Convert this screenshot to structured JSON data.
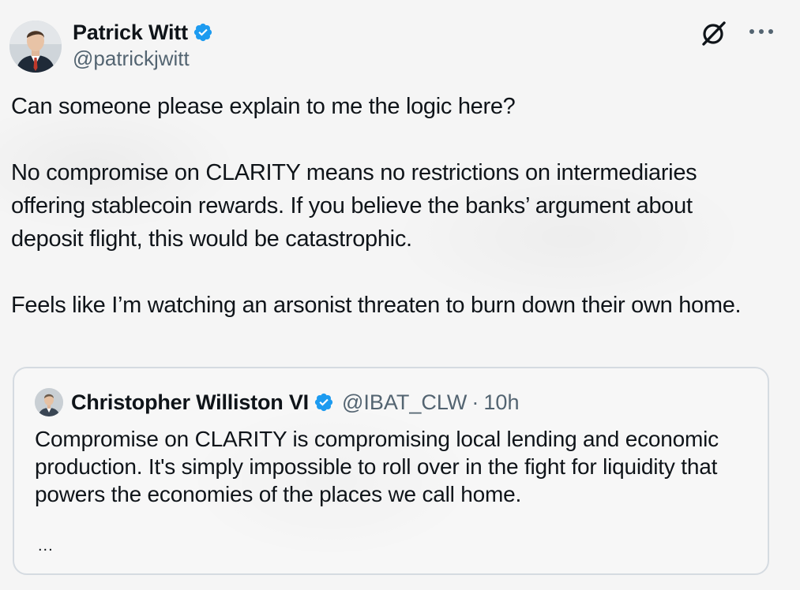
{
  "author": {
    "display_name": "Patrick Witt",
    "handle": "@patrickjwitt",
    "verified": true
  },
  "icons": {
    "verified": "verified-badge-icon",
    "grok": "grok-icon",
    "more": "more-options-icon"
  },
  "tweet": {
    "paragraphs": [
      "Can someone please explain to me the logic here?",
      "No compromise on CLARITY means no restrictions on intermediaries offering stablecoin rewards. If you believe the banks’ argument about deposit flight, this would be catastrophic.",
      "Feels like I’m watching an arsonist threaten to burn down their own home."
    ]
  },
  "quote": {
    "display_name": "Christopher Williston VI",
    "handle": "@IBAT_CLW",
    "separator": "·",
    "time": "10h",
    "verified": true,
    "text": "Compromise on CLARITY is compromising local lending and economic production.  It's simply impossible to roll over in the fight for liquidity that powers the economies of the places we call home.",
    "truncation": "..."
  },
  "colors": {
    "verified_blue": "#1d9bf0",
    "text_primary": "#0f1419",
    "text_secondary": "#536471",
    "border": "#d5dbe1"
  }
}
